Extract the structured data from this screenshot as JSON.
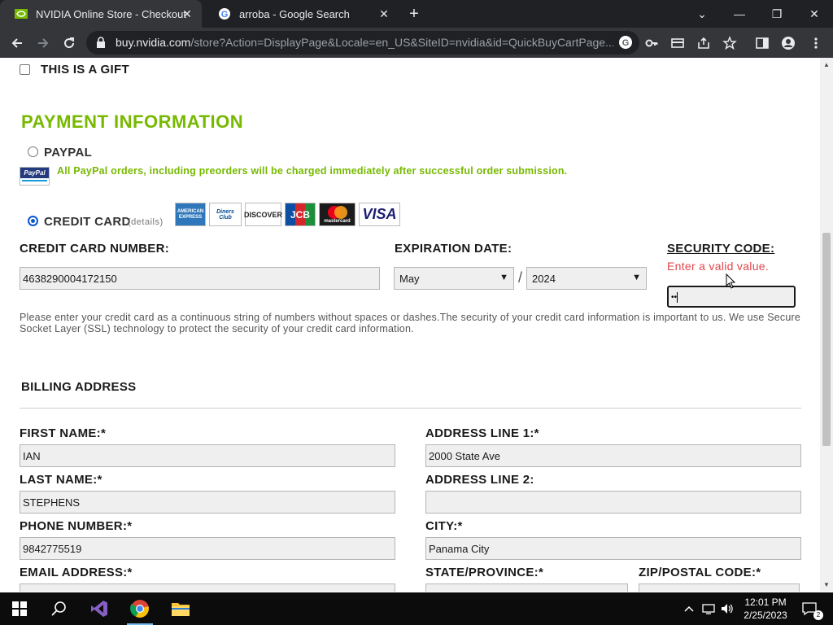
{
  "browser": {
    "tabs": [
      {
        "title": "NVIDIA Online Store - Checkout",
        "active": true,
        "icon": "nvidia-icon"
      },
      {
        "title": "arroba - Google Search",
        "active": false,
        "icon": "google-icon"
      }
    ],
    "url_host": "buy.nvidia.com",
    "url_path": "/store?Action=DisplayPage&Locale=en_US&SiteID=nvidia&id=QuickBuyCartPage..."
  },
  "page": {
    "gift_label": "THIS IS A GIFT",
    "payment_heading": "PAYMENT INFORMATION",
    "paypal_label": "PAYPAL",
    "paypal_logo": "PayPal",
    "paypal_notice": "All PayPal orders, including preorders will be charged immediately after successful order submission.",
    "credit_card_label": "CREDIT CARD",
    "details_link": "(details)",
    "card_brands": [
      "AMERICAN EXPRESS",
      "Diners Club",
      "DISCOVER",
      "JCB",
      "mastercard",
      "VISA"
    ],
    "cc_number_label": "CREDIT CARD NUMBER:",
    "cc_number_value": "4638290004172150",
    "expiration_label": "EXPIRATION DATE:",
    "exp_month": "May",
    "exp_separator": "/",
    "exp_year": "2024",
    "security_code_label": "SECURITY CODE:",
    "security_code_error": "Enter a valid value.",
    "security_code_value": "••",
    "cc_note": "Please enter your credit card as a continuous string of numbers without spaces or dashes.The security of your credit card information is important to us. We use Secure Socket Layer (SSL) technology to protect the security of your credit card information.",
    "billing_heading": "BILLING ADDRESS",
    "first_name_label": "FIRST NAME:*",
    "first_name_value": "IAN",
    "last_name_label": "LAST NAME:*",
    "last_name_value": "STEPHENS",
    "phone_label": "PHONE NUMBER:*",
    "phone_value": "9842775519",
    "email_label": "EMAIL ADDRESS:*",
    "address1_label": "ADDRESS LINE 1:*",
    "address1_value": "2000 State Ave",
    "address2_label": "ADDRESS LINE 2:",
    "address2_value": "",
    "city_label": "CITY:*",
    "city_value": "Panama City",
    "state_label": "STATE/PROVINCE:*",
    "zip_label": "ZIP/POSTAL CODE:*"
  },
  "taskbar": {
    "time": "12:01 PM",
    "date": "2/25/2023"
  },
  "colors": {
    "nvidia_green": "#76b900",
    "error_red": "#e0474c"
  }
}
